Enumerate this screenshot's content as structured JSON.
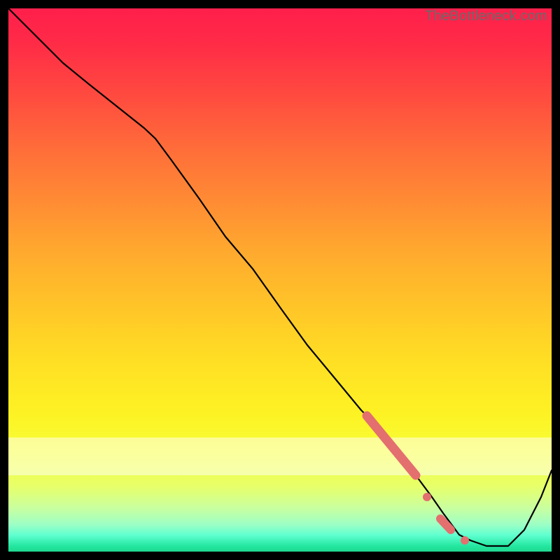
{
  "watermark": "TheBottleneck.com",
  "colors": {
    "frame_border": "#000000",
    "line": "#000000",
    "marker": "#e36f6f",
    "gradient_top": "#ff1f4b",
    "gradient_bottom": "#1fd98f"
  },
  "chart_data": {
    "type": "line",
    "title": "",
    "xlabel": "",
    "ylabel": "",
    "xlim": [
      0,
      100
    ],
    "ylim": [
      0,
      100
    ],
    "grid": false,
    "legend": false,
    "notes": "Axes tick labels are hidden; background is a vertical red→yellow→green gradient. Lower y (near green) = better (no bottleneck).",
    "series": [
      {
        "name": "bottleneck-curve",
        "x": [
          0,
          5,
          10,
          15,
          20,
          25,
          27,
          30,
          35,
          40,
          45,
          50,
          55,
          60,
          65,
          70,
          71,
          73,
          75,
          78,
          80,
          83,
          85,
          88,
          90,
          92,
          95,
          98,
          100
        ],
        "y": [
          100,
          95,
          90,
          86,
          82,
          78,
          76,
          72,
          65,
          58,
          52,
          45,
          38,
          32,
          26,
          21,
          20,
          17,
          14,
          10,
          7,
          3,
          2,
          1,
          1,
          1,
          4,
          10,
          15
        ]
      }
    ],
    "markers": [
      {
        "name": "highlight-segment",
        "shape": "thick-line",
        "color": "#e36f6f",
        "x": [
          66,
          75
        ],
        "y": [
          25,
          14
        ]
      },
      {
        "name": "point-a",
        "shape": "dot",
        "color": "#e36f6f",
        "x": 77,
        "y": 10
      },
      {
        "name": "point-b-segment",
        "shape": "short-thick-line",
        "color": "#e36f6f",
        "x": [
          79.5,
          81.5
        ],
        "y": [
          6,
          4
        ]
      },
      {
        "name": "point-c",
        "shape": "dot",
        "color": "#e36f6f",
        "x": 84,
        "y": 2
      }
    ],
    "white_band": {
      "top_pct": 79,
      "height_pct": 7
    }
  }
}
